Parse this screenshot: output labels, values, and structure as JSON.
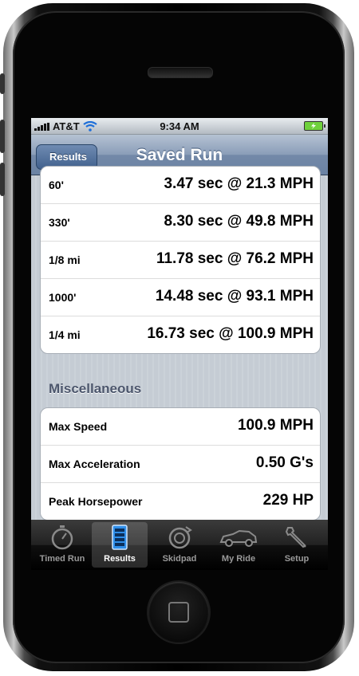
{
  "status_bar": {
    "carrier": "AT&T",
    "time": "9:34 AM",
    "icons": [
      "signal-bars-icon",
      "wifi-icon",
      "battery-charging-icon"
    ]
  },
  "nav": {
    "back_label": "Results",
    "title": "Saved Run"
  },
  "runs": [
    {
      "label": "60'",
      "value": "3.47 sec @ 21.3 MPH"
    },
    {
      "label": "330'",
      "value": "8.30 sec @ 49.8 MPH"
    },
    {
      "label": "1/8 mi",
      "value": "11.78 sec @ 76.2 MPH"
    },
    {
      "label": "1000'",
      "value": "14.48 sec @ 93.1 MPH"
    },
    {
      "label": "1/4 mi",
      "value": "16.73 sec @ 100.9 MPH"
    }
  ],
  "misc": {
    "header": "Miscellaneous",
    "rows": [
      {
        "label": "Max Speed",
        "value": "100.9 MPH"
      },
      {
        "label": "Max Acceleration",
        "value": "0.50 G's"
      },
      {
        "label": "Peak Horsepower",
        "value": "229 HP"
      }
    ]
  },
  "tabs": [
    {
      "label": "Timed Run",
      "icon": "stopwatch-icon",
      "active": false
    },
    {
      "label": "Results",
      "icon": "results-list-icon",
      "active": true
    },
    {
      "label": "Skidpad",
      "icon": "skidpad-icon",
      "active": false
    },
    {
      "label": "My Ride",
      "icon": "car-icon",
      "active": false
    },
    {
      "label": "Setup",
      "icon": "wrench-icon",
      "active": false
    }
  ],
  "colors": {
    "nav_bar": "#7389a8",
    "background": "#c5ccd4",
    "section_header": "#4c566c",
    "tab_bar": "#111111"
  }
}
